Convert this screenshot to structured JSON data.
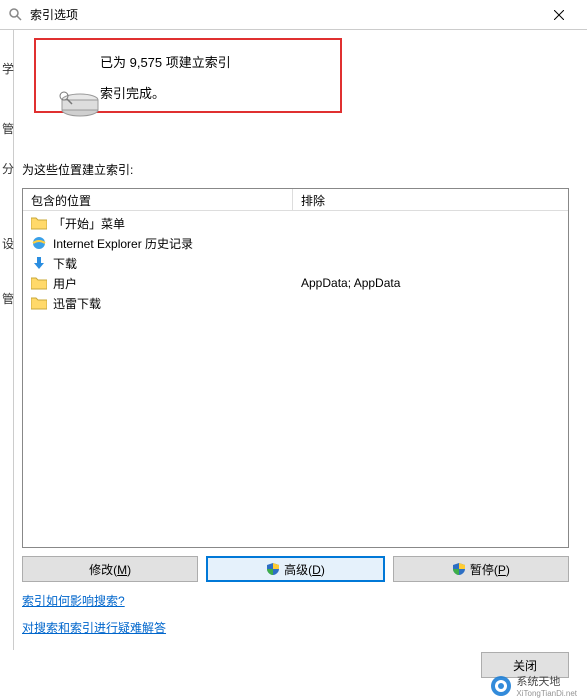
{
  "window": {
    "title": "索引选项"
  },
  "status": {
    "line1": "已为 9,575 项建立索引",
    "line2": "索引完成。"
  },
  "section_label": "为这些位置建立索引:",
  "columns": {
    "included": "包含的位置",
    "excluded": "排除"
  },
  "rows": [
    {
      "icon": "folder",
      "label": "「开始」菜单",
      "excluded": ""
    },
    {
      "icon": "ie",
      "label": "Internet Explorer 历史记录",
      "excluded": ""
    },
    {
      "icon": "download",
      "label": "下载",
      "excluded": ""
    },
    {
      "icon": "folder",
      "label": "用户",
      "excluded": "AppData; AppData"
    },
    {
      "icon": "folder",
      "label": "迅雷下载",
      "excluded": ""
    }
  ],
  "buttons": {
    "modify": "修改(M)",
    "advanced": "高级(D)",
    "pause": "暂停(P)",
    "close": "关闭"
  },
  "links": {
    "how_affect": "索引如何影响搜索?",
    "troubleshoot": "对搜索和索引进行疑难解答"
  },
  "left_labels": [
    "学",
    "管",
    "分",
    "设",
    "管"
  ],
  "watermark": {
    "name": "系统天地",
    "url": "XiTongTianDi.net"
  }
}
